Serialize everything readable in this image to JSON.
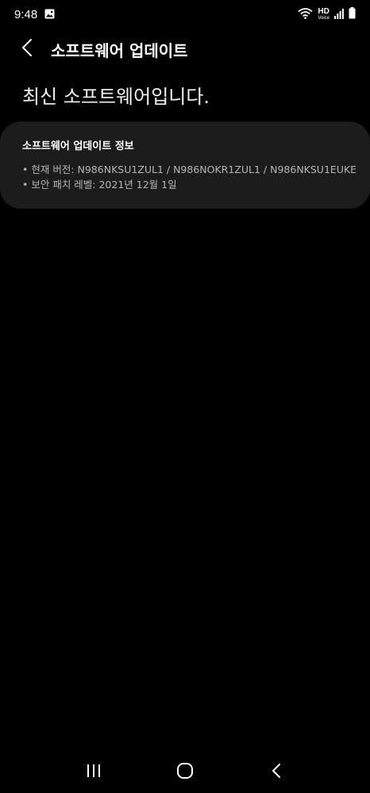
{
  "status_bar": {
    "time": "9:48",
    "hd_label": "HD",
    "voice_label": "Voice",
    "icons": [
      "image-icon",
      "wifi-icon",
      "signal-icon",
      "battery-icon"
    ]
  },
  "header": {
    "title": "소프트웨어 업데이트",
    "back_icon": "chevron-left-icon"
  },
  "main": {
    "headline": "최신 소프트웨어입니다."
  },
  "info_card": {
    "title": "소프트웨어 업데이트 정보",
    "lines": [
      "• 현재 버전: N986NKSU1ZUL1 / N986NOKR1ZUL1 / N986NKSU1EUKE",
      "• 보안 패치 레벨: 2021년 12월 1일"
    ]
  },
  "nav_bar": {
    "buttons": [
      "recent-apps-icon",
      "home-icon",
      "back-icon"
    ]
  },
  "colors": {
    "background": "#000000",
    "card": "#1c1c1c",
    "secondary_text": "#b5b5b5"
  }
}
